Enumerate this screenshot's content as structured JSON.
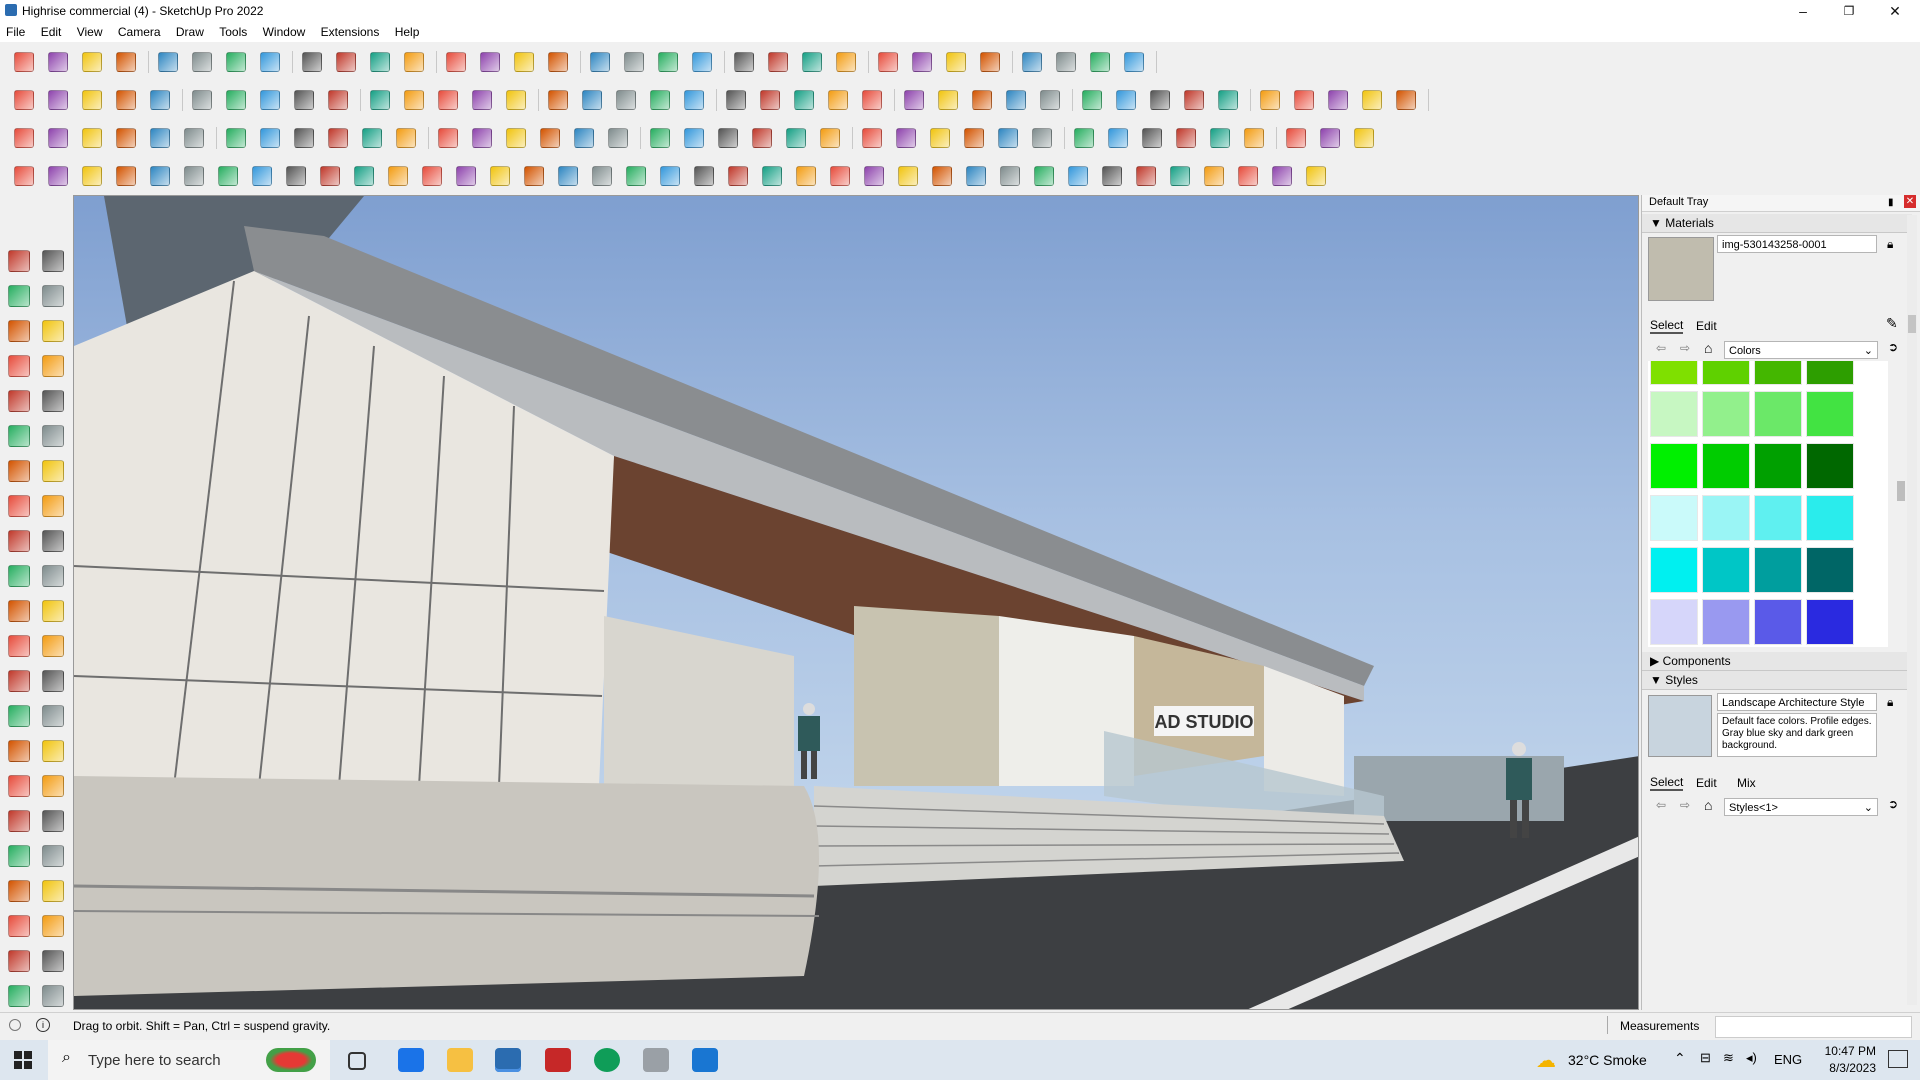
{
  "window": {
    "title": "Highrise commercial (4) - SketchUp Pro 2022",
    "minimize": "–",
    "maximize": "❐",
    "close": "✕"
  },
  "menu": [
    "File",
    "Edit",
    "View",
    "Camera",
    "Draw",
    "Tools",
    "Window",
    "Extensions",
    "Help"
  ],
  "tray": {
    "title": "Default Tray",
    "materials": {
      "header": "Materials",
      "name": "img-530143258-0001",
      "tabs": [
        "Select",
        "Edit"
      ],
      "collection": "Colors",
      "swatches": [
        "#7fe000",
        "#5fd100",
        "#44b700",
        "#2d9e00",
        "#c7f7c2",
        "#92f08c",
        "#6be868",
        "#42e342",
        "#00f000",
        "#00cc00",
        "#00a000",
        "#006800",
        "#cafafa",
        "#9af5f5",
        "#5ff0f0",
        "#2aecec",
        "#00f0f0",
        "#00c6c6",
        "#009e9e",
        "#006666",
        "#d6d6fa",
        "#9999f0",
        "#5a5ae8",
        "#2a2ae0"
      ]
    },
    "components": {
      "header": "Components"
    },
    "styles": {
      "header": "Styles",
      "name": "Landscape Architecture Style",
      "description": "Default face colors. Profile edges. Gray blue sky and dark green background.",
      "tabs": [
        "Select",
        "Edit",
        "Mix"
      ],
      "collection": "Styles<1>"
    }
  },
  "status": {
    "hint": "Drag to orbit. Shift = Pan, Ctrl = suspend gravity.",
    "measurements_label": "Measurements"
  },
  "scene": {
    "sign_text": "AD STUDIO"
  },
  "taskbar": {
    "search_placeholder": "Type here to search",
    "weather": "32°C  Smoke",
    "language": "ENG",
    "time": "10:47 PM",
    "date": "8/3/2023"
  },
  "colors": {
    "accent": "#2b6cb0",
    "sky_top": "#7f9fd0",
    "sky_bottom": "#cfe0f0"
  }
}
